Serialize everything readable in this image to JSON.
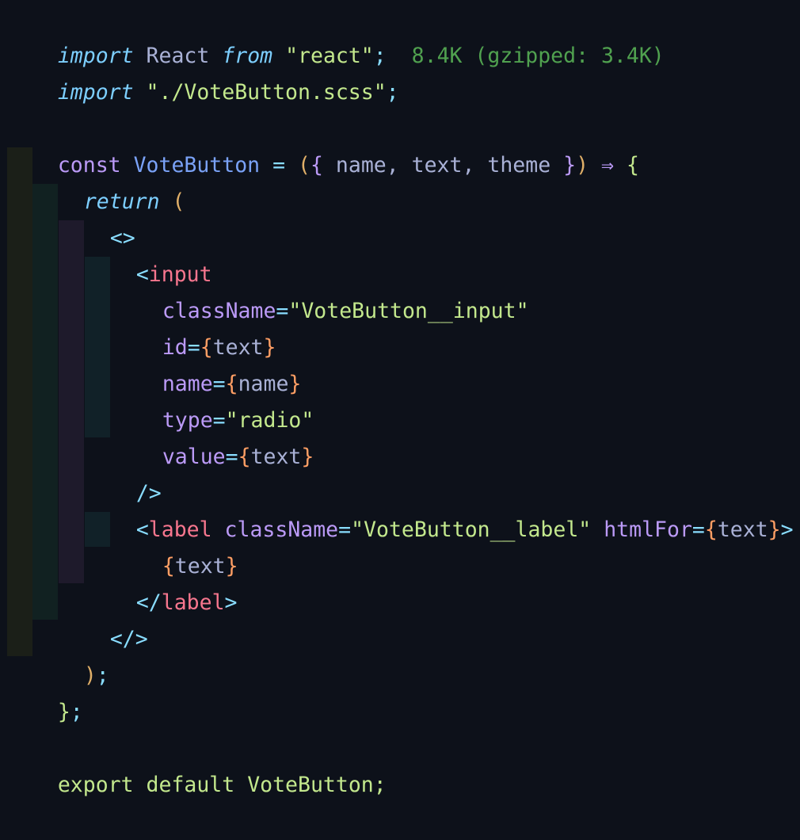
{
  "editor": {
    "colors": {
      "background": "#0d111a",
      "keyword_italic": "#7dcfff",
      "keyword": "#bb9af7",
      "function_name": "#7aa2f7",
      "string": "#c3e88d",
      "punctuation": "#89ddff",
      "paren": "#e0af68",
      "tag": "#f7768e",
      "attribute": "#bb9af7",
      "brace": "#ff9e64",
      "plain": "#a9b1d6",
      "import_cost": "#50a14f"
    },
    "lines": [
      {
        "tokens": [
          "import",
          " ",
          "React",
          " ",
          "from",
          " ",
          "\"react\"",
          ";",
          "  ",
          "8.4K (gzipped: 3.4K)"
        ]
      },
      {
        "tokens": [
          "import",
          " ",
          "\"./VoteButton.scss\"",
          ";"
        ]
      },
      {
        "tokens": []
      },
      {
        "tokens": [
          "const",
          " ",
          "VoteButton",
          " ",
          "=",
          " ",
          "(",
          "{",
          " name, text, theme ",
          "}",
          ")",
          " ",
          "⇒",
          " ",
          "{"
        ]
      },
      {
        "tokens": [
          "return",
          " ",
          "("
        ]
      },
      {
        "tokens": [
          "<>"
        ]
      },
      {
        "tokens": [
          "<",
          "input"
        ]
      },
      {
        "tokens": [
          "className",
          "=",
          "\"VoteButton__input\""
        ]
      },
      {
        "tokens": [
          "id",
          "=",
          "{",
          "text",
          "}"
        ]
      },
      {
        "tokens": [
          "name",
          "=",
          "{",
          "name",
          "}"
        ]
      },
      {
        "tokens": [
          "type",
          "=",
          "\"radio\""
        ]
      },
      {
        "tokens": [
          "value",
          "=",
          "{",
          "text",
          "}"
        ]
      },
      {
        "tokens": [
          "/>"
        ]
      },
      {
        "tokens": [
          "<",
          "label",
          " ",
          "className",
          "=",
          "\"VoteButton__label\"",
          " ",
          "htmlFor",
          "=",
          "{",
          "text",
          "}",
          ">"
        ]
      },
      {
        "tokens": [
          "{",
          "text",
          "}"
        ]
      },
      {
        "tokens": [
          "</",
          "label",
          ">"
        ]
      },
      {
        "tokens": [
          "</>"
        ]
      },
      {
        "tokens": [
          ")",
          ";"
        ]
      },
      {
        "tokens": [
          "}",
          ";"
        ]
      },
      {
        "tokens": []
      },
      {
        "tokens": [
          "export",
          " ",
          "default",
          " ",
          "VoteButton",
          ";"
        ]
      }
    ]
  }
}
